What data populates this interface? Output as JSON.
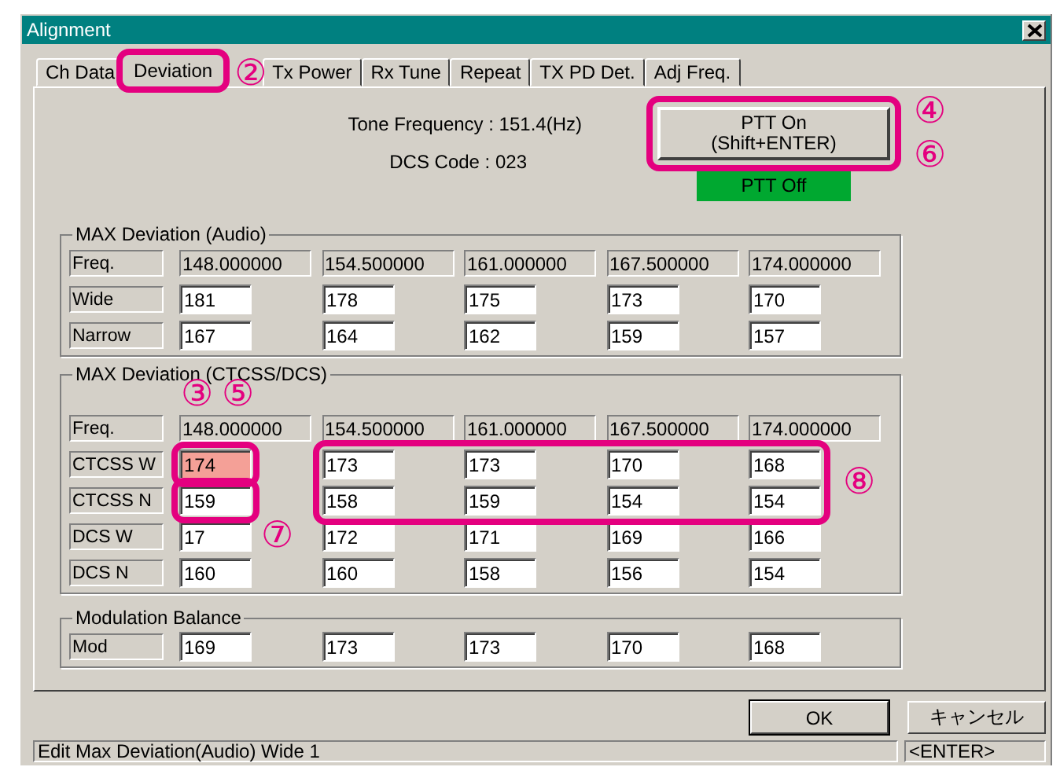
{
  "window": {
    "title": "Alignment"
  },
  "tabs": [
    {
      "label": "Ch Data",
      "selected": false
    },
    {
      "label": "Deviation",
      "selected": true
    },
    {
      "label": "Tx Power",
      "selected": false
    },
    {
      "label": "Rx Tune",
      "selected": false
    },
    {
      "label": "Repeat",
      "selected": false
    },
    {
      "label": "TX PD Det.",
      "selected": false
    },
    {
      "label": "Adj Freq.",
      "selected": false
    }
  ],
  "tone_frequency": "Tone Frequency : 151.4(Hz)",
  "dcs_code": "DCS Code : 023",
  "ptt_button": [
    "PTT On",
    "(Shift+ENTER)"
  ],
  "ptt_status": {
    "label": "PTT Off",
    "lit": true
  },
  "groups": [
    {
      "title": "MAX Deviation (Audio)",
      "rows": [
        {
          "label": "Freq.",
          "kind": "readonly",
          "cells": [
            {
              "value": "148.000000"
            },
            {
              "value": "154.500000"
            },
            {
              "value": "161.000000"
            },
            {
              "value": "167.500000"
            },
            {
              "value": "174.000000"
            }
          ]
        },
        {
          "label": "Wide",
          "kind": "input",
          "cells": [
            {
              "value": "181",
              "highlighted": false
            },
            {
              "value": "178",
              "highlighted": false
            },
            {
              "value": "175",
              "highlighted": false
            },
            {
              "value": "173",
              "highlighted": false
            },
            {
              "value": "170",
              "highlighted": false
            }
          ]
        },
        {
          "label": "Narrow",
          "kind": "input",
          "cells": [
            {
              "value": "167",
              "highlighted": false
            },
            {
              "value": "164",
              "highlighted": false
            },
            {
              "value": "162",
              "highlighted": false
            },
            {
              "value": "159",
              "highlighted": false
            },
            {
              "value": "157",
              "highlighted": false
            }
          ]
        }
      ]
    },
    {
      "title": "MAX Deviation (CTCSS/DCS)",
      "rows": [
        {
          "label": "Freq.",
          "kind": "readonly",
          "cells": [
            {
              "value": "148.000000"
            },
            {
              "value": "154.500000"
            },
            {
              "value": "161.000000"
            },
            {
              "value": "167.500000"
            },
            {
              "value": "174.000000"
            }
          ]
        },
        {
          "label": "CTCSS W",
          "kind": "input",
          "cells": [
            {
              "value": "174",
              "highlighted": true
            },
            {
              "value": "173",
              "highlighted": false
            },
            {
              "value": "173",
              "highlighted": false
            },
            {
              "value": "170",
              "highlighted": false
            },
            {
              "value": "168",
              "highlighted": false
            }
          ]
        },
        {
          "label": "CTCSS N",
          "kind": "input",
          "cells": [
            {
              "value": "159",
              "highlighted": false
            },
            {
              "value": "158",
              "highlighted": false
            },
            {
              "value": "159",
              "highlighted": false
            },
            {
              "value": "154",
              "highlighted": false
            },
            {
              "value": "154",
              "highlighted": false
            }
          ]
        },
        {
          "label": "DCS W",
          "kind": "input",
          "cells": [
            {
              "value": "17",
              "highlighted": false
            },
            {
              "value": "172",
              "highlighted": false
            },
            {
              "value": "171",
              "highlighted": false
            },
            {
              "value": "169",
              "highlighted": false
            },
            {
              "value": "166",
              "highlighted": false
            }
          ]
        },
        {
          "label": "DCS N",
          "kind": "input",
          "cells": [
            {
              "value": "160",
              "highlighted": false
            },
            {
              "value": "160",
              "highlighted": false
            },
            {
              "value": "158",
              "highlighted": false
            },
            {
              "value": "156",
              "highlighted": false
            },
            {
              "value": "154",
              "highlighted": false
            }
          ]
        }
      ]
    },
    {
      "title": "Modulation Balance",
      "rows": [
        {
          "label": "Mod",
          "kind": "input",
          "cells": [
            {
              "value": "169",
              "highlighted": false
            },
            {
              "value": "173",
              "highlighted": false
            },
            {
              "value": "173",
              "highlighted": false
            },
            {
              "value": "170",
              "highlighted": false
            },
            {
              "value": "168",
              "highlighted": false
            }
          ]
        }
      ]
    }
  ],
  "buttons": [
    "OK",
    "キャンセル"
  ],
  "status_bar": {
    "message": "Edit Max Deviation(Audio) Wide 1",
    "key": "<ENTER>"
  },
  "callouts": {
    "markers": [
      "②",
      "③",
      "⑤",
      "④",
      "⑥",
      "⑦",
      "⑧"
    ]
  }
}
